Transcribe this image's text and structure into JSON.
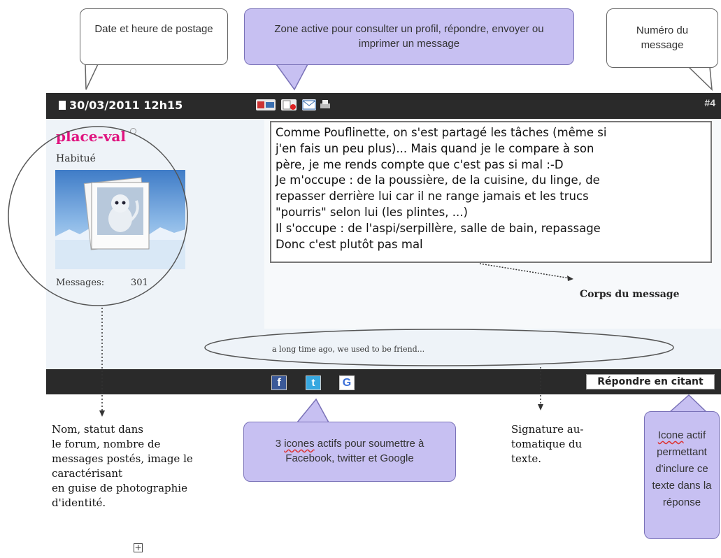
{
  "callouts": {
    "date": "Date et heure de postage",
    "active_zone": "Zone active pour consulter un profil, répondre, envoyer ou imprimer un message",
    "msg_number": "Numéro du message",
    "share_prefix": "3 ",
    "share_spell": "icones",
    "share_rest": " actifs pour soumettre à Facebook, twitter et Google",
    "quote_spell": "Icone",
    "quote_rest": " actif permettant d'inclure ce texte dans la réponse"
  },
  "post": {
    "date": "30/03/2011 12h15",
    "number": "#4",
    "username": "place-val",
    "status": "Habitué",
    "messages_label": "Messages:",
    "messages_count": "301",
    "body_lines": [
      "Comme Pouflinette, on s'est partagé les tâches (même si",
      "j'en fais un peu plus)... Mais quand je le compare à son",
      "père, je me rends compte que c'est pas si mal :-D",
      "Je m'occupe : de la poussière, de la cuisine, du linge, de",
      "repasser derrière lui car il ne range jamais et les trucs",
      "\"pourris\" selon lui (les plintes, ...)",
      "Il s'occupe : de l'aspi/serpillère, salle de bain, repassage",
      "Donc c'est plutôt pas mal"
    ],
    "signature": "a long time ago, we used to be friend...",
    "reply_quote_label": "Répondre en citant"
  },
  "annotations": {
    "body_label": "Corps du message",
    "profile_note": [
      "Nom, statut dans",
      "le forum, nombre de",
      "messages postés, image le",
      "caractérisant",
      "en guise de photographie",
      "d'identité."
    ],
    "signature_note": [
      "Signature au-",
      "tomatique du",
      "texte."
    ]
  },
  "icons": {
    "doc": "document-icon",
    "profile": "profile-icon",
    "pm": "private-message-icon",
    "email": "email-icon",
    "print": "print-icon",
    "facebook": "facebook-icon",
    "twitter": "twitter-icon",
    "google": "google-icon",
    "expand": "plus-box-icon"
  },
  "colors": {
    "bar": "#2a2a2a",
    "username": "#e0137f",
    "callout_purple": "#c7c0f2",
    "panel": "#eef3f8"
  }
}
